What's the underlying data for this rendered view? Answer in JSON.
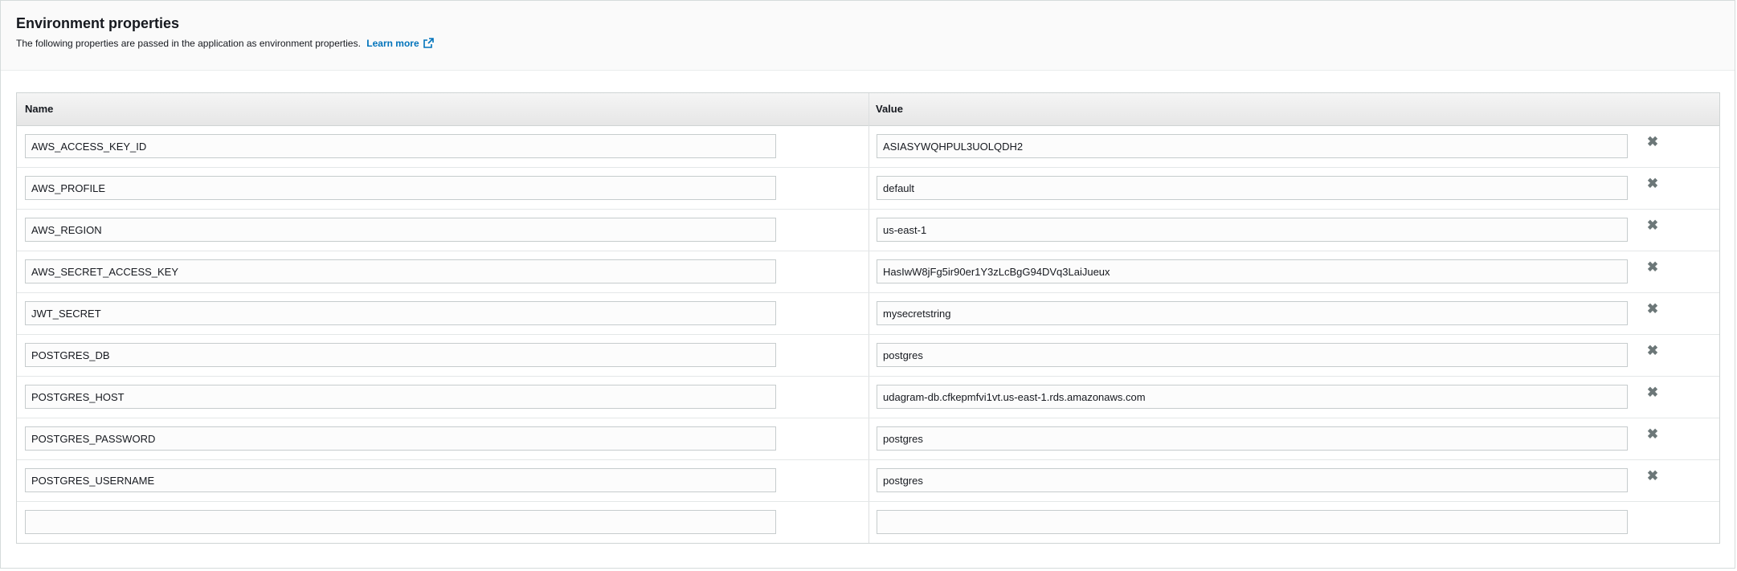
{
  "section": {
    "title": "Environment properties",
    "description": "The following properties are passed in the application as environment properties.",
    "learn_more": "Learn more"
  },
  "table": {
    "headers": {
      "name": "Name",
      "value": "Value"
    },
    "remove_glyph": "✖",
    "rows": [
      {
        "name": "AWS_ACCESS_KEY_ID",
        "value": "ASIASYWQHPUL3UOLQDH2"
      },
      {
        "name": "AWS_PROFILE",
        "value": "default"
      },
      {
        "name": "AWS_REGION",
        "value": "us-east-1"
      },
      {
        "name": "AWS_SECRET_ACCESS_KEY",
        "value": "HasIwW8jFg5ir90er1Y3zLcBgG94DVq3LaiJueux"
      },
      {
        "name": "JWT_SECRET",
        "value": "mysecretstring"
      },
      {
        "name": "POSTGRES_DB",
        "value": "postgres"
      },
      {
        "name": "POSTGRES_HOST",
        "value": "udagram-db.cfkepmfvi1vt.us-east-1.rds.amazonaws.com"
      },
      {
        "name": "POSTGRES_PASSWORD",
        "value": "postgres"
      },
      {
        "name": "POSTGRES_USERNAME",
        "value": "postgres"
      },
      {
        "name": "",
        "value": ""
      }
    ]
  },
  "colors": {
    "link": "#0073bb",
    "header_bg": "#fafafa",
    "border": "#d5dbdb"
  }
}
